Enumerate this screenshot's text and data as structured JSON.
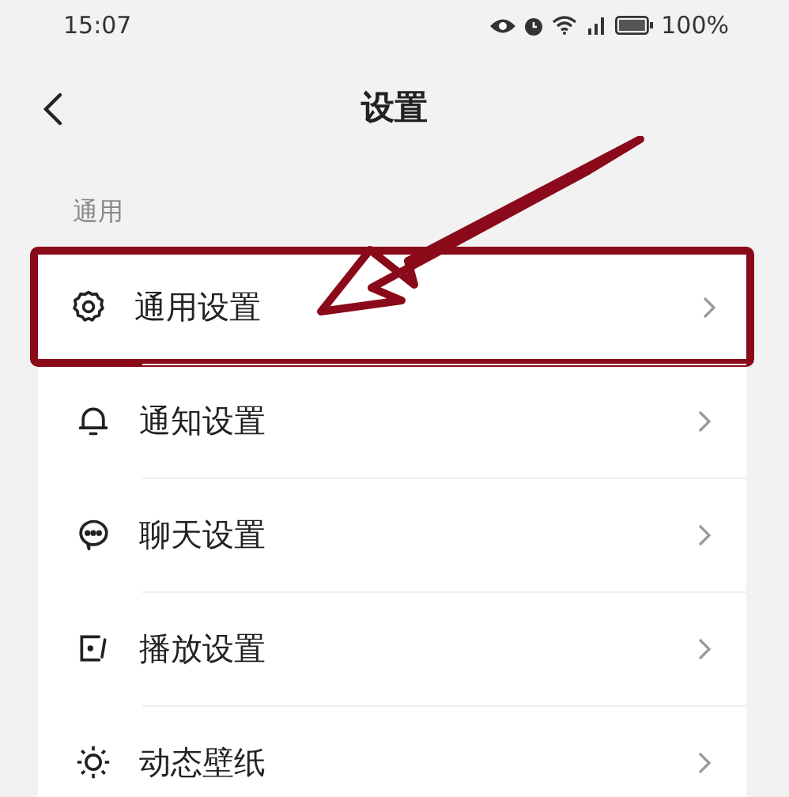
{
  "status_bar": {
    "time": "15:07",
    "battery": "100%"
  },
  "header": {
    "title": "设置"
  },
  "section": {
    "label": "通用"
  },
  "items": [
    {
      "label": "通用设置",
      "highlighted": true
    },
    {
      "label": "通知设置",
      "highlighted": false
    },
    {
      "label": "聊天设置",
      "highlighted": false
    },
    {
      "label": "播放设置",
      "highlighted": false
    },
    {
      "label": "动态壁纸",
      "highlighted": false
    }
  ]
}
